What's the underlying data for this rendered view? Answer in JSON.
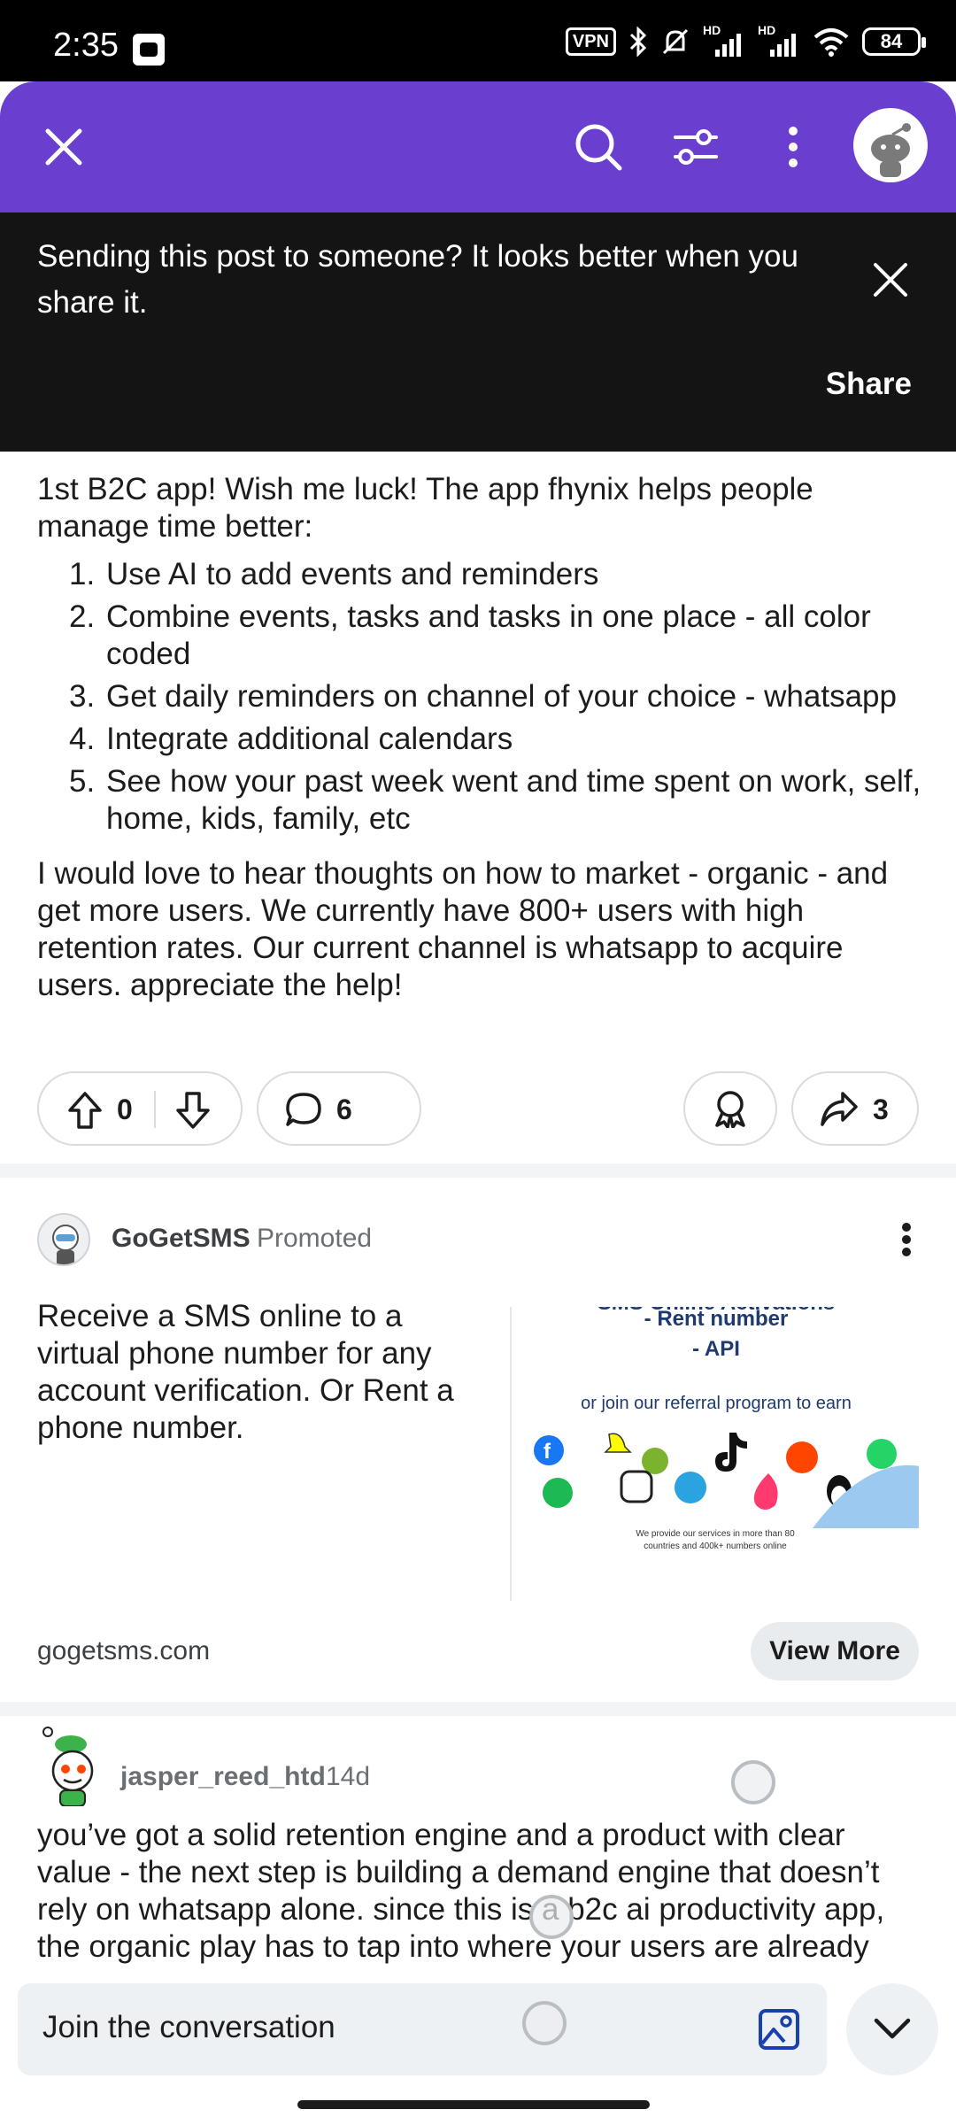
{
  "status_bar": {
    "time": "2:35",
    "vpn": "VPN",
    "sig1": "HD",
    "sig2": "HD",
    "battery": "84"
  },
  "header": {
    "close_icon": "close-icon",
    "search_icon": "search-icon",
    "filter_icon": "sort-icon",
    "menu_icon": "more-vertical-icon",
    "avatar_icon": "snoo-avatar"
  },
  "share_banner": {
    "text": "Sending this post to someone? It looks better when you share it.",
    "share_label": "Share"
  },
  "post": {
    "intro": "1st B2C app! Wish me luck! The app fhynix helps people manage time better:",
    "list": [
      {
        "num": "1.",
        "text": "Use AI to add events and reminders"
      },
      {
        "num": "2.",
        "text": "Combine events, tasks and tasks in one place - all color coded"
      },
      {
        "num": "3.",
        "text": "Get daily reminders on channel of your choice - whatsapp"
      },
      {
        "num": "4.",
        "text": "Integrate additional calendars"
      },
      {
        "num": "5.",
        "text": "See how your past week went and time spent on work, self, home, kids, family, etc"
      }
    ],
    "paragraph": "I would love to hear thoughts on how to market - organic - and get more users. We currently have 800+ users with high retention rates. Our current channel is whatsapp to acquire users. appreciate the help!",
    "votes": "0",
    "comments": "6",
    "shares": "3"
  },
  "promoted": {
    "name": "GoGetSMS",
    "tag": "Promoted",
    "text": "Receive a SMS online to a virtual phone number for any account verification. Or Rent a phone number.",
    "image": {
      "line1": "SMS Online Activations",
      "line2": "- Rent number",
      "line3": "- API",
      "line4": "or join our referral program to earn",
      "footer": "We provide our services in more than 80 countries and 400k+ numbers online"
    },
    "url": "gogetsms.com",
    "cta": "View More"
  },
  "comment": {
    "username": "jasper_reed_htd",
    "time": "14d",
    "text": "you’ve got a solid retention engine and a product with clear value - the next step is building a demand engine that doesn’t rely on whatsapp alone. since this is a b2c ai productivity app, the organic play has to tap into where your users are already"
  },
  "composer": {
    "placeholder": "Join the conversation"
  },
  "colors": {
    "brand": "#6a3fcf",
    "banner": "#141414"
  }
}
